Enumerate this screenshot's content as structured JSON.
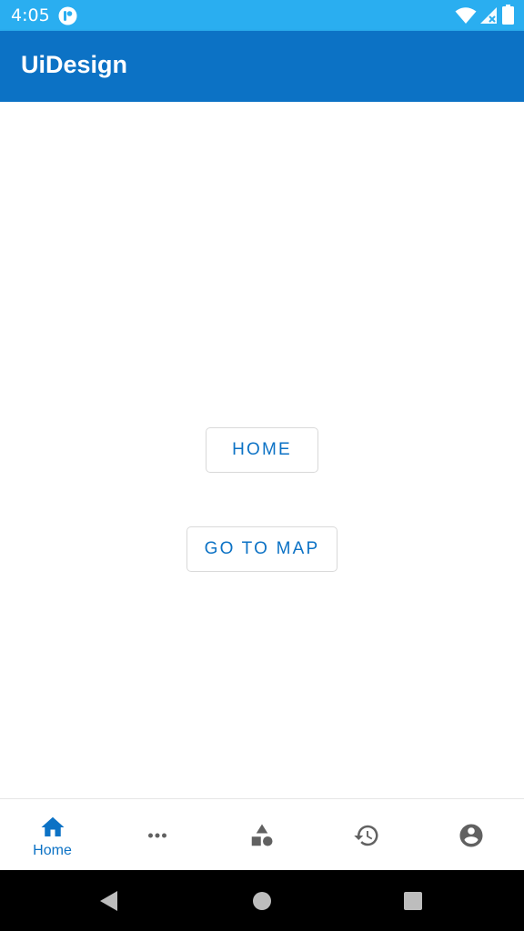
{
  "status_bar": {
    "time": "4:05",
    "app_icon": "app-notification-icon",
    "wifi_icon": "wifi-icon",
    "signal_icon": "signal-no-service-icon",
    "battery_icon": "battery-full-icon",
    "background": "#2aaef0"
  },
  "app_bar": {
    "title": "UiDesign",
    "background": "#0c72c5"
  },
  "main": {
    "home_button_label": "HOME",
    "map_button_label": "GO TO MAP",
    "accent_color": "#0c72c5"
  },
  "bottom_nav": {
    "items": [
      {
        "id": "home",
        "label": "Home",
        "icon": "home-icon",
        "selected": true
      },
      {
        "id": "more",
        "label": "",
        "icon": "more-horizontal-icon",
        "selected": false
      },
      {
        "id": "shapes",
        "label": "",
        "icon": "shapes-icon",
        "selected": false
      },
      {
        "id": "history",
        "label": "",
        "icon": "history-icon",
        "selected": false
      },
      {
        "id": "account",
        "label": "",
        "icon": "account-circle-icon",
        "selected": false
      }
    ]
  },
  "system_nav": {
    "back_icon": "back-triangle-icon",
    "home_icon": "home-circle-icon",
    "recents_icon": "recents-square-icon"
  }
}
